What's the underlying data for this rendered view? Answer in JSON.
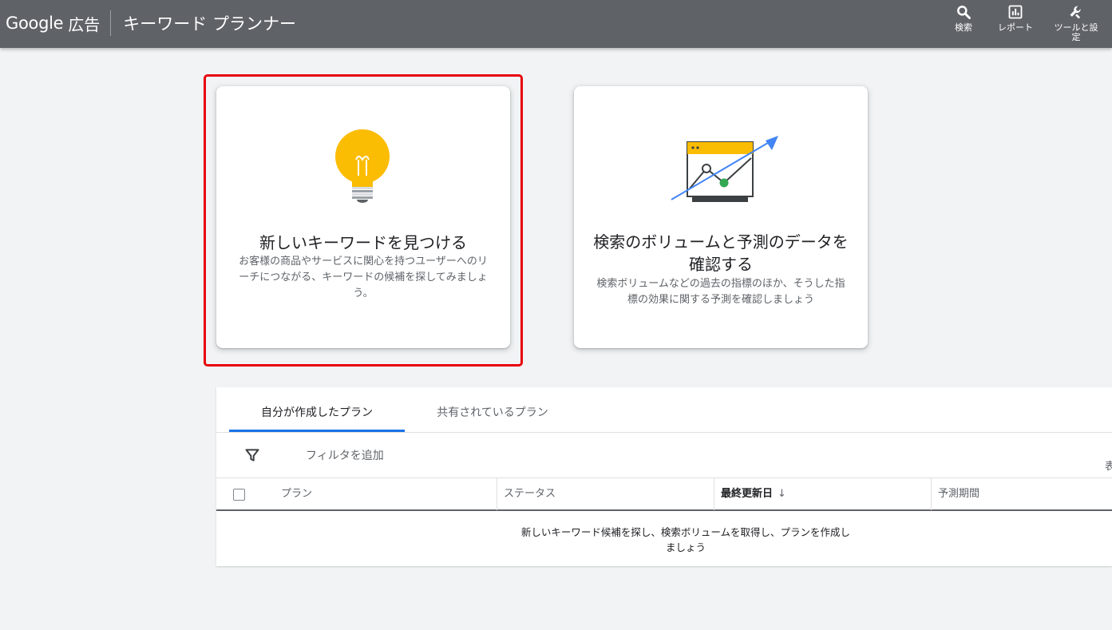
{
  "header": {
    "brand_google": "Google",
    "brand_ads": "広告",
    "page_title": "キーワード プランナー",
    "actions": [
      {
        "label": "検索",
        "icon": "search-icon"
      },
      {
        "label": "レポート",
        "icon": "report-icon"
      },
      {
        "label": "ツールと設定",
        "icon": "wrench-icon"
      }
    ]
  },
  "cards": {
    "find_keywords": {
      "title": "新しいキーワードを見つける",
      "description": "お客様の商品やサービスに関心を持つユーザーへのリーチにつながる、キーワードの候補を探してみましょう。",
      "icon": "lightbulb-icon"
    },
    "forecast": {
      "title": "検索のボリュームと予測のデータを確認する",
      "description": "検索ボリュームなどの過去の指標のほか、そうした指標の効果に関する予測を確認しましょう",
      "icon": "trend-chart-icon"
    }
  },
  "plans": {
    "tabs": [
      "自分が作成したプラン",
      "共有されているプラン"
    ],
    "active_tab": "自分が作成したプラン",
    "filter_label": "フィルタを追加",
    "cut_off_text": "表",
    "columns": [
      "プラン",
      "ステータス",
      "最終更新日",
      "予測期間"
    ],
    "sort_column": "最終更新日",
    "sort_direction": "descending",
    "empty_message": "新しいキーワード候補を探し、検索ボリュームを取得し、プランを作成しましょう"
  },
  "colors": {
    "header_bg": "#5f6368",
    "highlight_border": "#e8000b",
    "bulb": "#fbbc04",
    "trend_arrow": "#4285f4",
    "point_green": "#34a853",
    "active_tab": "#1a73e8"
  }
}
